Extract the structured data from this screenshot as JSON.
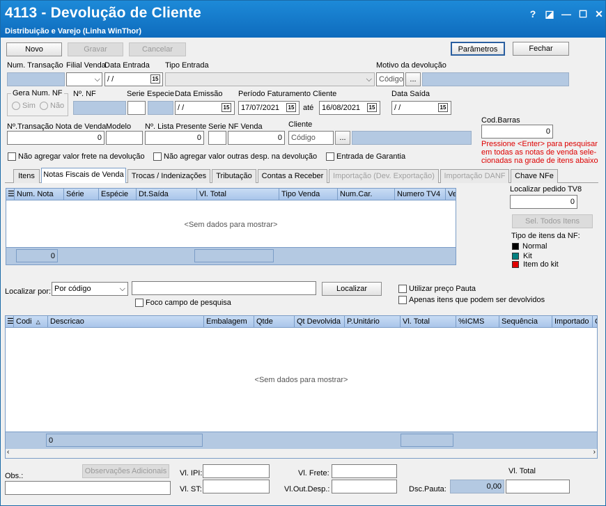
{
  "window": {
    "title": "4113 - Devolução de Cliente",
    "subtitle": "Distribuição e Varejo (Linha WinThor)",
    "help": "?",
    "restore": "◪",
    "minimize": "—",
    "maximize": "☐",
    "close": "✕"
  },
  "toolbar": {
    "novo": "Novo",
    "gravar": "Gravar",
    "cancelar": "Cancelar",
    "parametros": "Parâmetros",
    "fechar": "Fechar"
  },
  "form": {
    "num_transacao": "Num. Transação",
    "filial_venda": "Filial Venda",
    "data_entrada": "Data Entrada",
    "data_entrada_value": " / /",
    "tipo_entrada": "Tipo Entrada",
    "motivo": "Motivo da devolução",
    "codigo_placeholder": "Código",
    "ellipsis": "...",
    "gera_num_nf": "Gera Num. NF",
    "sim": "Sim",
    "nao": "Não",
    "num_nf": "Nº. NF",
    "serie": "Serie",
    "especie": "Especie",
    "data_emissao": "Data Emissão",
    "data_emissao_value": " / /",
    "periodo": "Período Faturamento Cliente",
    "periodo_de": "17/07/2021",
    "ate": "até",
    "periodo_ate": "16/08/2021",
    "data_saida": "Data Saída",
    "data_saida_value": " / /",
    "cod_barras": "Cod.Barras",
    "cod_barras_value": "0",
    "transacao_nota": "Nº.Transação Nota de Venda",
    "transacao_nota_value": "0",
    "modelo": "Modelo",
    "lista_presente": "Nº. Lista Presente",
    "lista_presente_value": "0",
    "serie_nf_venda": "Serie NF Venda",
    "serie_nf_venda_value": "0",
    "cliente": "Cliente",
    "cliente_placeholder": "Código",
    "hint": "Pressione  <Enter> para pesquisar em todas as notas de venda sele- cionadas na grade de itens abaixo",
    "chk_frete": "Não agregar valor frete  na devolução",
    "chk_outras": "Não agregar valor outras desp. na devolução",
    "chk_garantia": "Entrada de Garantia"
  },
  "tabs": [
    {
      "label": "Itens"
    },
    {
      "label": "Notas Fiscais de Venda"
    },
    {
      "label": "Trocas / Indenizações"
    },
    {
      "label": "Tributação"
    },
    {
      "label": "Contas a Receber"
    },
    {
      "label": "Importação (Dev. Exportação)"
    },
    {
      "label": "Importação DANF"
    },
    {
      "label": "Chave NFe"
    }
  ],
  "grid1": {
    "columns": [
      "Num. Nota",
      "Série",
      "Espécie",
      "Dt.Saída",
      "Vl. Total",
      "Tipo Venda",
      "Num.Car.",
      "Numero TV4",
      "Ver"
    ],
    "empty": "<Sem dados para mostrar>",
    "footer_count": "0"
  },
  "side": {
    "localizar_pedido": "Localizar pedido TV8",
    "localizar_pedido_value": "0",
    "sel_todos": "Sel. Todos Itens",
    "tipo_itens": "Tipo de itens da NF:",
    "legend": [
      {
        "label": "Normal",
        "color": "#000000"
      },
      {
        "label": "Kit",
        "color": "#008080"
      },
      {
        "label": "Item do kit",
        "color": "#e00000"
      }
    ]
  },
  "search": {
    "localizar_por": "Localizar por:",
    "option": "Por código",
    "button": "Localizar",
    "foco": "Foco campo de pesquisa",
    "preco_pauta": "Utilizar preço Pauta",
    "apenas_itens": "Apenas itens que podem ser devolvidos"
  },
  "grid2": {
    "columns": [
      "Codi",
      "Descricao",
      "Embalagem",
      "Qtde",
      "Qt Devolvida",
      "P.Unitário",
      "Vl. Total",
      "%ICMS",
      "Sequência",
      "Importado",
      "C"
    ],
    "empty": "<Sem dados para mostrar>",
    "footer_count": "0"
  },
  "bottom": {
    "obs": "Obs.:",
    "obs_adicionais": "Observações Adicionais",
    "vl_ipi": "Vl. IPI:",
    "vl_st": "Vl. ST:",
    "vl_frete": "Vl. Frete:",
    "vl_out": "Vl.Out.Desp.:",
    "vl_total": "Vl. Total",
    "dsc_pauta": "Dsc.Pauta:",
    "dsc_pauta_value": "0,00"
  }
}
